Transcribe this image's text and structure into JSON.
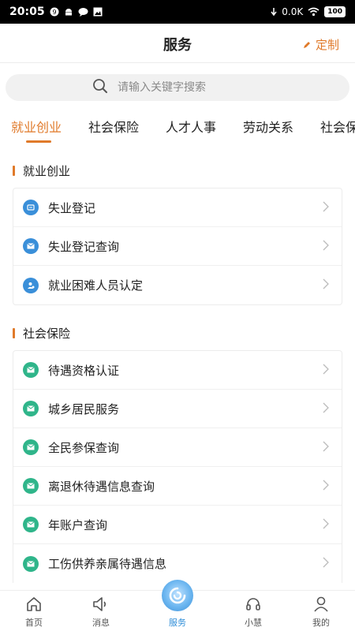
{
  "status_bar": {
    "time": "20:05",
    "speed": "0.0K",
    "battery": "100"
  },
  "header": {
    "title": "服务",
    "customize_label": "定制"
  },
  "search": {
    "placeholder": "请输入关键字搜索"
  },
  "tabs": [
    {
      "label": "就业创业",
      "active": true
    },
    {
      "label": "社会保险",
      "active": false
    },
    {
      "label": "人才人事",
      "active": false
    },
    {
      "label": "劳动关系",
      "active": false
    },
    {
      "label": "社会保",
      "active": false
    }
  ],
  "sections": [
    {
      "title": "就业创业",
      "items": [
        {
          "label": "失业登记",
          "icon": "id-card-icon",
          "color": "#3a8fd9"
        },
        {
          "label": "失业登记查询",
          "icon": "mail-icon",
          "color": "#3a8fd9"
        },
        {
          "label": "就业困难人员认定",
          "icon": "person-icon",
          "color": "#3a8fd9"
        }
      ]
    },
    {
      "title": "社会保险",
      "items": [
        {
          "label": "待遇资格认证",
          "icon": "mail-icon",
          "color": "#2fb58a"
        },
        {
          "label": "城乡居民服务",
          "icon": "mail-icon",
          "color": "#2fb58a"
        },
        {
          "label": "全民参保查询",
          "icon": "mail-icon",
          "color": "#2fb58a"
        },
        {
          "label": "离退休待遇信息查询",
          "icon": "mail-icon",
          "color": "#2fb58a"
        },
        {
          "label": "年账户查询",
          "icon": "mail-icon",
          "color": "#2fb58a"
        },
        {
          "label": "工伤供养亲属待遇信息",
          "icon": "mail-icon",
          "color": "#2fb58a"
        }
      ]
    }
  ],
  "bottom_nav": [
    {
      "label": "首页",
      "icon": "home-icon",
      "active": false
    },
    {
      "label": "消息",
      "icon": "speaker-icon",
      "active": false
    },
    {
      "label": "服务",
      "icon": "service-icon",
      "active": true
    },
    {
      "label": "小慧",
      "icon": "headset-icon",
      "active": false
    },
    {
      "label": "我的",
      "icon": "user-icon",
      "active": false
    }
  ],
  "colors": {
    "accent": "#e07a2a",
    "blue": "#3a8fd9",
    "green": "#2fb58a",
    "nav_active": "#2f8ed8"
  }
}
